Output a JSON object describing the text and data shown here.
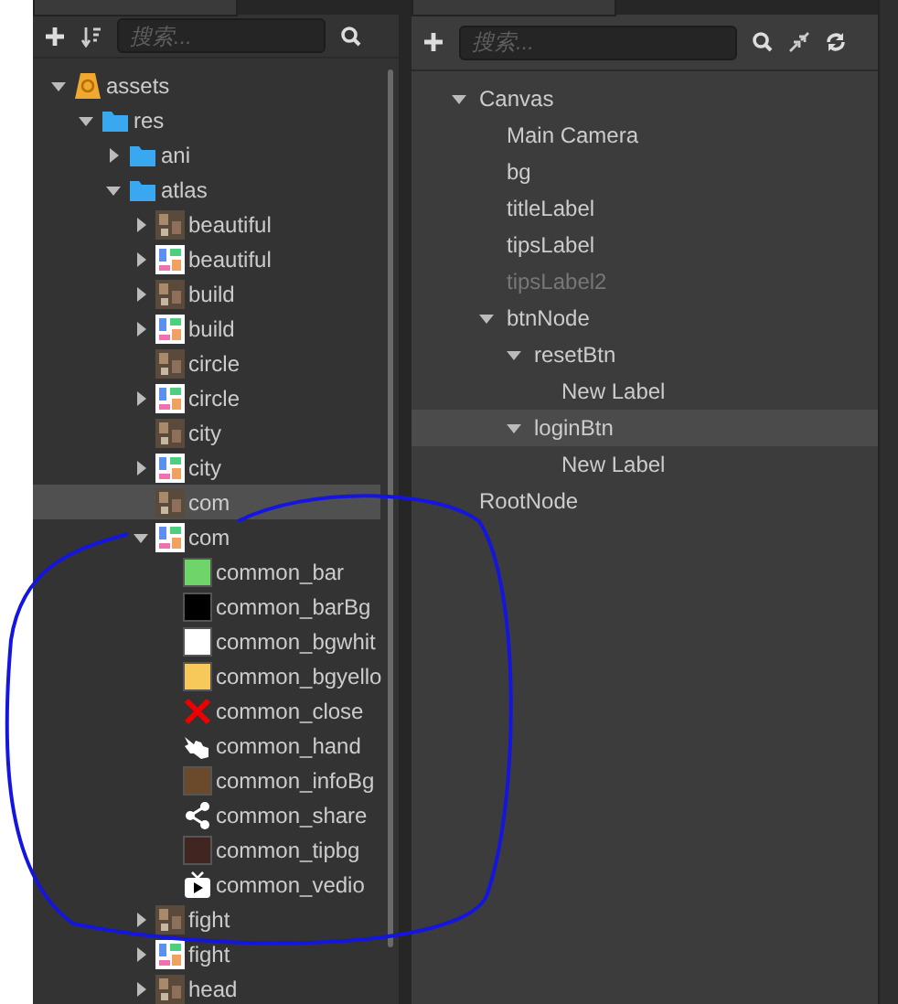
{
  "assets_panel": {
    "search": {
      "placeholder": "搜索..."
    },
    "tree": [
      {
        "label": "assets",
        "kind": "root",
        "expanded": true,
        "selected": false,
        "children": [
          {
            "label": "res",
            "kind": "folder",
            "expanded": true,
            "selected": false,
            "children": [
              {
                "label": "ani",
                "kind": "folder",
                "expanded": false,
                "selected": false
              },
              {
                "label": "atlas",
                "kind": "folder",
                "expanded": true,
                "selected": false,
                "children": [
                  {
                    "label": "beautiful",
                    "kind": "texture",
                    "expanded": false,
                    "selected": false
                  },
                  {
                    "label": "beautiful",
                    "kind": "atlas",
                    "expanded": false,
                    "selected": false
                  },
                  {
                    "label": "build",
                    "kind": "texture",
                    "expanded": false,
                    "selected": false
                  },
                  {
                    "label": "build",
                    "kind": "atlas",
                    "expanded": false,
                    "selected": false
                  },
                  {
                    "label": "circle",
                    "kind": "texture",
                    "selected": false
                  },
                  {
                    "label": "circle",
                    "kind": "atlas",
                    "expanded": false,
                    "selected": false
                  },
                  {
                    "label": "city",
                    "kind": "texture",
                    "selected": false
                  },
                  {
                    "label": "city",
                    "kind": "atlas",
                    "expanded": false,
                    "selected": false
                  },
                  {
                    "label": "com",
                    "kind": "texture",
                    "selected": true
                  },
                  {
                    "label": "com",
                    "kind": "atlas",
                    "expanded": true,
                    "selected": false,
                    "children": [
                      {
                        "label": "common_bar",
                        "kind": "swatch",
                        "color": "#6fd46a",
                        "selected": false
                      },
                      {
                        "label": "common_barBg",
                        "kind": "swatch",
                        "color": "#000000",
                        "selected": false
                      },
                      {
                        "label": "common_bgwhit",
                        "kind": "swatch",
                        "color": "#ffffff",
                        "selected": false
                      },
                      {
                        "label": "common_bgyello",
                        "kind": "swatch",
                        "color": "#f7c95a",
                        "selected": false
                      },
                      {
                        "label": "common_close",
                        "kind": "cross",
                        "selected": false
                      },
                      {
                        "label": "common_hand",
                        "kind": "hand",
                        "selected": false
                      },
                      {
                        "label": "common_infoBg",
                        "kind": "swatch",
                        "color": "#6b4a2b",
                        "selected": false
                      },
                      {
                        "label": "common_share",
                        "kind": "share",
                        "selected": false
                      },
                      {
                        "label": "common_tipbg",
                        "kind": "swatch",
                        "color": "#3f2620",
                        "selected": false
                      },
                      {
                        "label": "common_vedio",
                        "kind": "video",
                        "selected": false
                      }
                    ]
                  },
                  {
                    "label": "fight",
                    "kind": "texture",
                    "expanded": false,
                    "selected": false
                  },
                  {
                    "label": "fight",
                    "kind": "atlas",
                    "expanded": false,
                    "selected": false
                  },
                  {
                    "label": "head",
                    "kind": "texture",
                    "expanded": false,
                    "selected": false
                  }
                ]
              }
            ]
          }
        ]
      }
    ]
  },
  "hierarchy_panel": {
    "search": {
      "placeholder": "搜索..."
    },
    "tree": [
      {
        "label": "Canvas",
        "expanded": true,
        "selected": false,
        "disabled": false,
        "children": [
          {
            "label": "Main Camera",
            "selected": false,
            "disabled": false
          },
          {
            "label": "bg",
            "selected": false,
            "disabled": false
          },
          {
            "label": "titleLabel",
            "selected": false,
            "disabled": false
          },
          {
            "label": "tipsLabel",
            "selected": false,
            "disabled": false
          },
          {
            "label": "tipsLabel2",
            "selected": false,
            "disabled": true
          },
          {
            "label": "btnNode",
            "expanded": true,
            "selected": false,
            "disabled": false,
            "children": [
              {
                "label": "resetBtn",
                "expanded": true,
                "selected": false,
                "disabled": false,
                "children": [
                  {
                    "label": "New Label",
                    "selected": false,
                    "disabled": false
                  }
                ]
              },
              {
                "label": "loginBtn",
                "expanded": true,
                "selected": true,
                "disabled": false,
                "children": [
                  {
                    "label": "New Label",
                    "selected": false,
                    "disabled": false
                  }
                ]
              }
            ]
          }
        ]
      },
      {
        "label": "RootNode",
        "selected": false,
        "disabled": false
      }
    ]
  }
}
